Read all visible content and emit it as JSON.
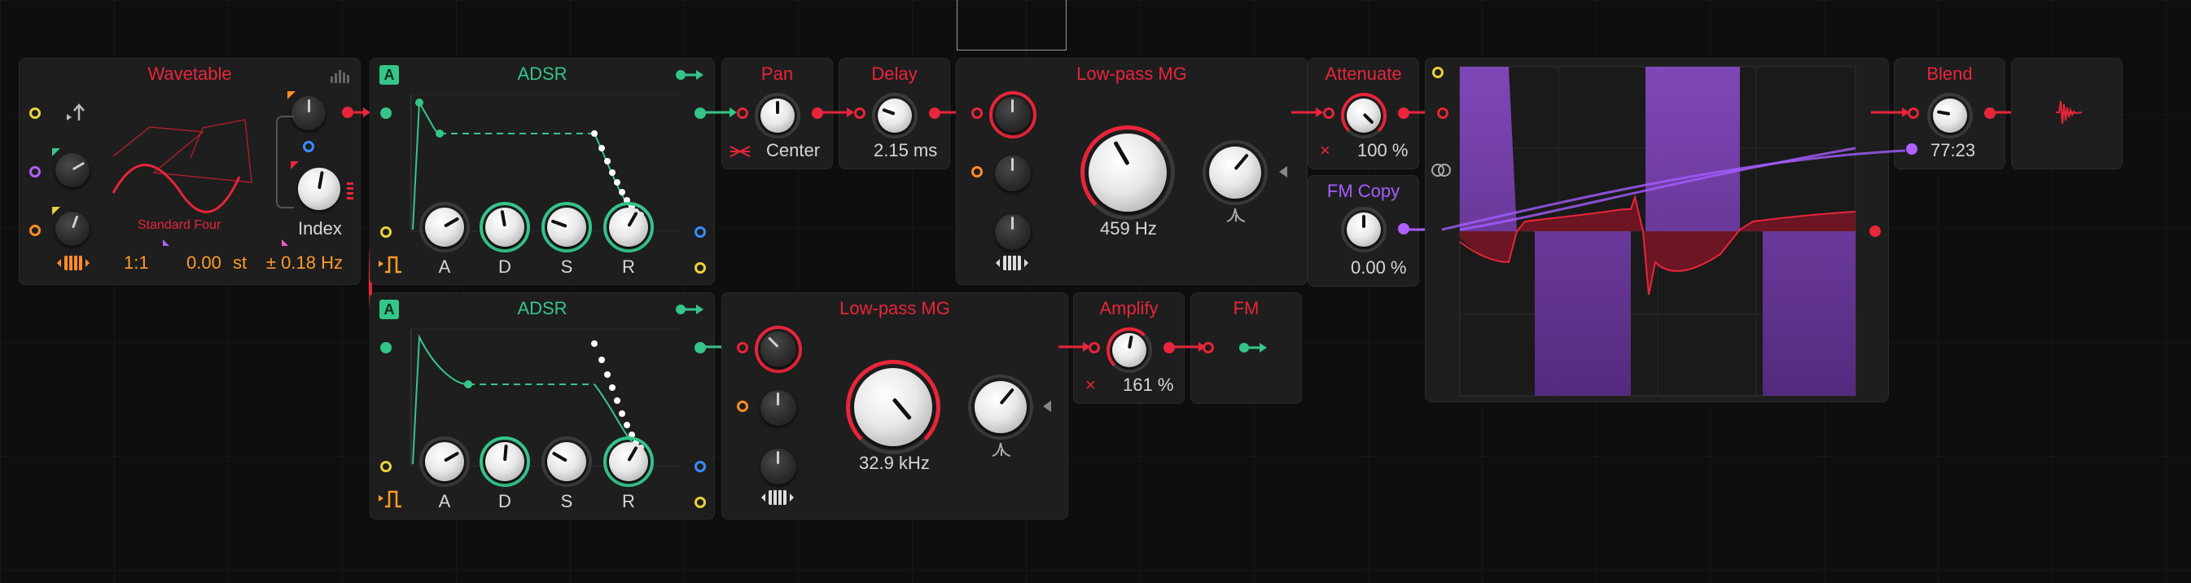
{
  "wavetable": {
    "title": "Wavetable",
    "table_name": "Standard Four",
    "ratio": "1:1",
    "pitch": "0.00",
    "pitch_unit": "st",
    "index_label": "Index",
    "rate": "± 0.18 Hz"
  },
  "adsr1": {
    "title": "ADSR",
    "badge": "A",
    "labels": [
      "A",
      "D",
      "S",
      "R"
    ]
  },
  "adsr2": {
    "title": "ADSR",
    "badge": "A",
    "labels": [
      "A",
      "D",
      "S",
      "R"
    ]
  },
  "pan": {
    "title": "Pan",
    "value": "Center"
  },
  "delay": {
    "title": "Delay",
    "value": "2.15 ms"
  },
  "lowpass1": {
    "title": "Low-pass MG",
    "cutoff": "459 Hz"
  },
  "lowpass2": {
    "title": "Low-pass MG",
    "cutoff": "32.9 kHz"
  },
  "attenuate": {
    "title": "Attenuate",
    "value": "100 %",
    "x": "×"
  },
  "fm_copy": {
    "title": "FM Copy",
    "value": "0.00 %"
  },
  "amplify": {
    "title": "Amplify",
    "value": "161 %",
    "x": "×"
  },
  "fm": {
    "title": "FM"
  },
  "blend": {
    "title": "Blend",
    "value": "77:23"
  },
  "colors": {
    "accent_red": "#e8253a",
    "accent_green": "#35c58a",
    "accent_purple": "#a55cff",
    "accent_orange": "#ff9a2b"
  }
}
